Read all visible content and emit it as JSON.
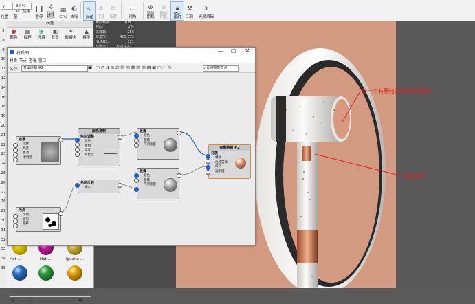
{
  "toolbar": {
    "combo1": "y",
    "combo2": "82 %",
    "items": [
      {
        "label": "位置"
      },
      {
        "label": "CPU 使用量"
      },
      {
        "label": "暂停"
      },
      {
        "label": "性能模式"
      },
      {
        "label": "GPU"
      },
      {
        "label": "去噪"
      },
      {
        "label": "选择"
      },
      {
        "label": "平移"
      },
      {
        "label": "旋转"
      },
      {
        "label": "视角"
      },
      {
        "label": "添加相机"
      },
      {
        "label": "删除相机"
      },
      {
        "label": "锁定相机"
      },
      {
        "label": "工具"
      },
      {
        "label": "光源编辑"
      }
    ]
  },
  "left_strip": [
    "2",
    "8",
    "9",
    "10",
    "11",
    "12",
    "14",
    "16",
    "18",
    "19",
    "20",
    "21",
    "22",
    "23",
    "24",
    "25",
    "26",
    "27",
    "28",
    "29",
    "30",
    "31",
    "32",
    "33",
    "34",
    "35"
  ],
  "materials_panel": {
    "title": "材质",
    "tabs": [
      {
        "label": "颜色"
      },
      {
        "label": "纹理"
      },
      {
        "label": "环境"
      },
      {
        "label": "背景"
      },
      {
        "label": "砂罐夫"
      },
      {
        "label": "模型"
      }
    ],
    "balls": [
      {
        "label": "Hot ...",
        "color": "#d8c300"
      },
      {
        "label": "Hot ...",
        "color": "#c21a9a"
      },
      {
        "label": "Iguana ...",
        "color": "#c8b230"
      },
      {
        "label": "",
        "color": "#2a6fc0"
      },
      {
        "label": "",
        "color": "#2e9a3a"
      },
      {
        "label": "",
        "color": "#e0a000"
      }
    ]
  },
  "stats": {
    "rows": [
      {
        "k": "每秒帧数:",
        "v": "108.1"
      },
      {
        "k": "时间:",
        "v": "47s"
      },
      {
        "k": "采样数:",
        "v": "256"
      },
      {
        "k": "三角形:",
        "v": "405,372"
      },
      {
        "k": "NURBS:",
        "v": "321"
      },
      {
        "k": "分辨率:",
        "v": "658 x 421"
      }
    ]
  },
  "graph_window": {
    "title": "材质图",
    "menu": [
      "材质",
      "节点",
      "查看",
      "窗口"
    ],
    "name_label": "名称:",
    "name_value": "金属绘制 #2",
    "search_placeholder": "几何图形节点",
    "nodes": {
      "texture": {
        "title": "遮罩",
        "rows": [
          "选择",
          "亮度",
          "色调",
          "透明度"
        ]
      },
      "adjust": {
        "title": "色彩调整",
        "header": "颜色复制",
        "rows": [
          "颜色",
          "色相",
          "亮度",
          "对比度"
        ]
      },
      "metal1": {
        "title": "金属",
        "rows": [
          "颜色",
          "粗糙",
          "平滑速度"
        ]
      },
      "invert": {
        "title": "色彩反转",
        "rows": [
          "输入"
        ]
      },
      "mask": {
        "title": "污点",
        "rows": [
          "比例",
          "变形",
          "偏移"
        ]
      },
      "metal2": {
        "title": "金属",
        "rows": [
          "颜色",
          "粗糙",
          "平滑速度"
        ]
      },
      "output": {
        "header": "金属绘制 #2",
        "title": "材质",
        "rows": [
          "材质",
          "位移置换",
          "凹凸",
          "透明度"
        ]
      }
    }
  },
  "annotations": {
    "top": "给一个有颗粒的喷漆材质即可",
    "bottom": "双层材质"
  },
  "colors": {
    "accent": "#1e63c9",
    "annotation": "#e02020",
    "wall": "#d39a82"
  }
}
